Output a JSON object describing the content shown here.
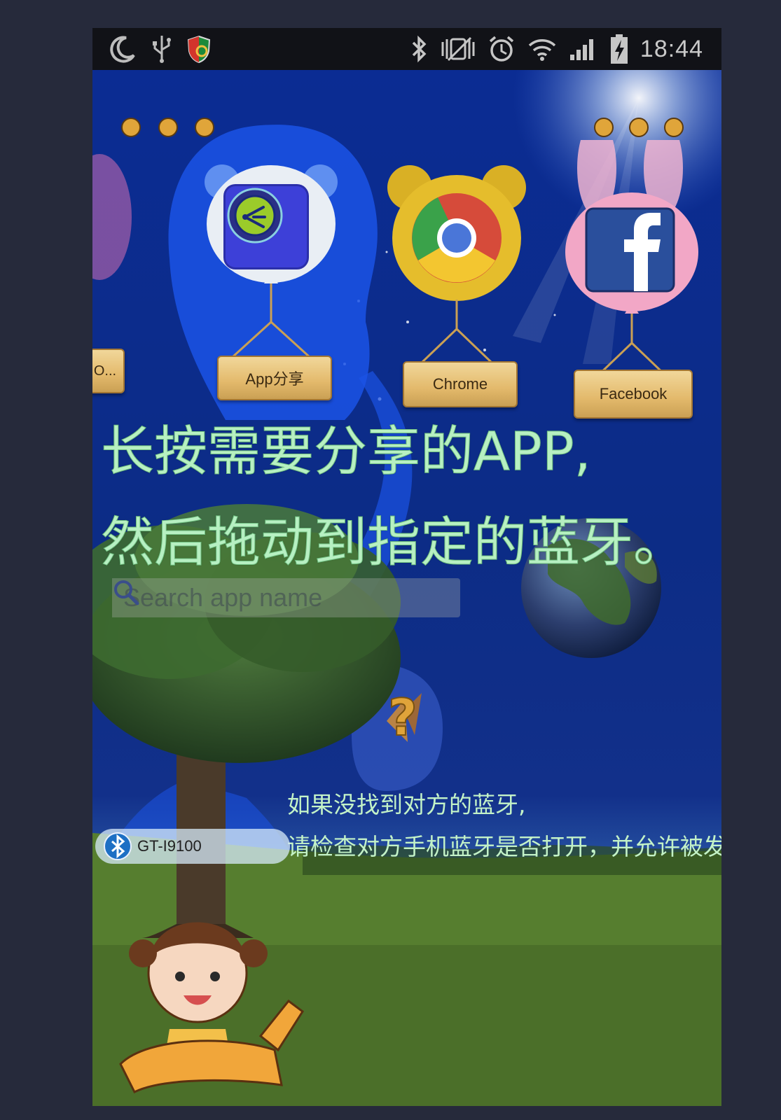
{
  "status_bar": {
    "time": "18:44",
    "icons": [
      "moon-icon",
      "usb-icon",
      "shield-icon",
      "bluetooth-icon",
      "vibrate-icon",
      "alarm-icon",
      "wifi-icon",
      "signal-icon",
      "battery-icon"
    ]
  },
  "apps": [
    {
      "label": "App分享",
      "icon": "share-icon"
    },
    {
      "label": "Chrome",
      "icon": "chrome-icon"
    },
    {
      "label": "Facebook",
      "icon": "facebook-icon"
    }
  ],
  "partial_app_label": "O...",
  "instruction": {
    "line1": "长按需要分享的APP,",
    "line2": "然后拖动到指定的蓝牙。"
  },
  "search": {
    "placeholder": "Search app name",
    "icon": "search-icon"
  },
  "help_icon": "help-icon",
  "hint": {
    "line1": "如果没找到对方的蓝牙,",
    "line2": "请检查对方手机蓝牙是否打开，并允许被发现。"
  },
  "devices": [
    {
      "name": "GT-I9100",
      "icon": "bluetooth-device-icon"
    }
  ],
  "colors": {
    "background": "#262a3b",
    "sky": "#0e2a82",
    "instruction_text": "#b7f0c2",
    "status_bar": "#111217"
  }
}
